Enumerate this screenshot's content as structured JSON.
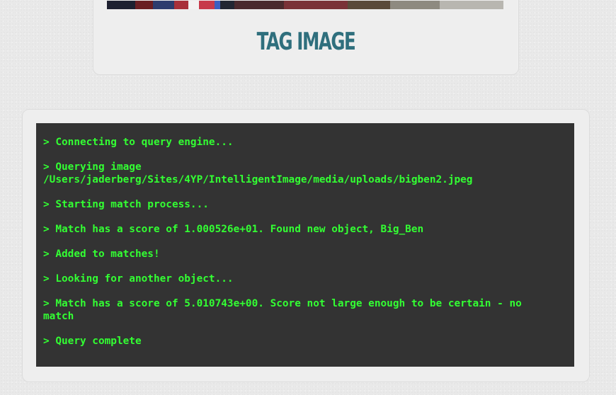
{
  "image_card": {
    "title": "TAG IMAGE"
  },
  "console": {
    "lines": [
      "> Connecting to query engine...",
      "> Querying image\n/Users/jaderberg/Sites/4YP/IntelligentImage/media/uploads/bigben2.jpeg",
      "> Starting match process...",
      "> Match has a score of 1.000526e+01. Found new object, Big_Ben",
      "> Added to matches!",
      "> Looking for another object...",
      "> Match has a score of 5.010743e+00. Score not large enough to be certain - no\nmatch",
      "> Query complete"
    ]
  },
  "colors": {
    "page_background": "#e9e9e9",
    "card_background": "#eeeeee",
    "title_color": "#2f6f7d",
    "console_background": "#333333",
    "console_text": "#33ff33"
  }
}
